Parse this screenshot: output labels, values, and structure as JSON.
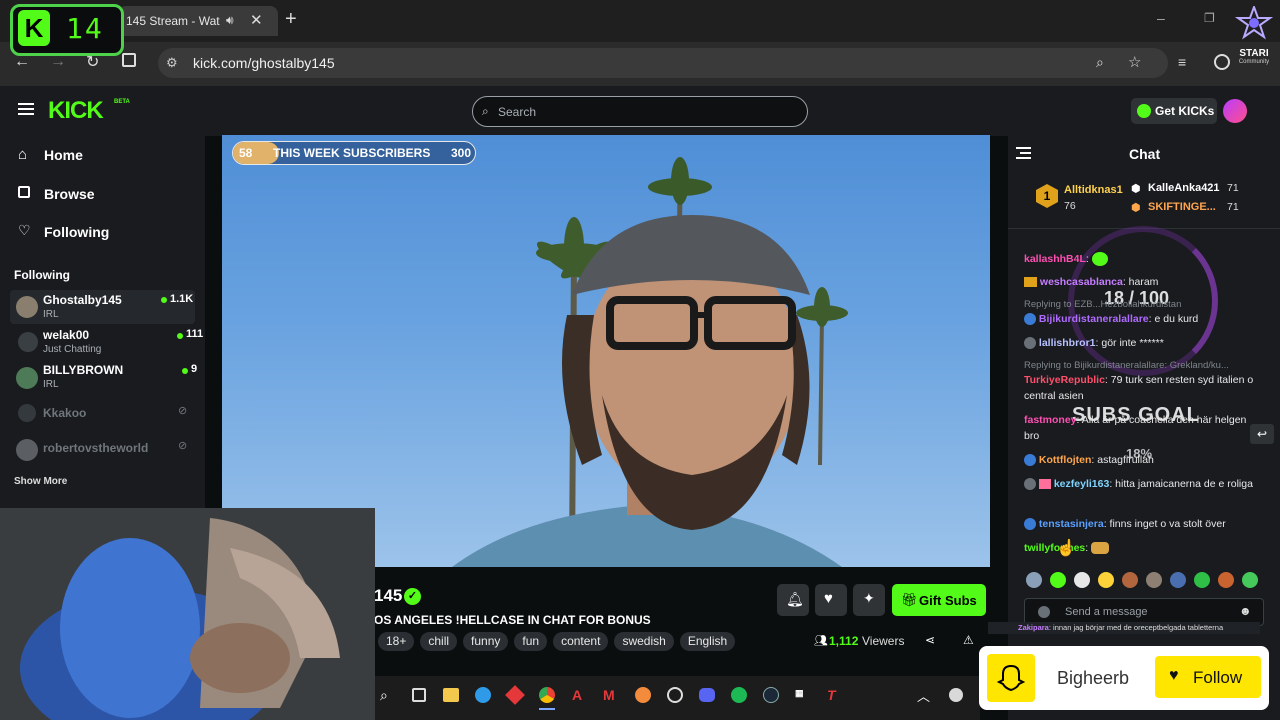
{
  "counter": {
    "k": "K",
    "value": "14"
  },
  "browser": {
    "tab_title": "145 Stream - Wat",
    "url": "kick.com/ghostalby145"
  },
  "corner_logo": {
    "label": "STARI",
    "sublabel": "Community"
  },
  "header": {
    "logo": "KICK",
    "logo_badge": "BETA",
    "search_placeholder": "Search",
    "get_kicks": "Get KICKs"
  },
  "sidebar": {
    "nav": [
      {
        "label": "Home",
        "icon": "home-icon"
      },
      {
        "label": "Browse",
        "icon": "browse-icon"
      },
      {
        "label": "Following",
        "icon": "heart-icon"
      }
    ],
    "following_title": "Following",
    "channels": [
      {
        "name": "Ghostalby145",
        "category": "IRL",
        "viewers": "1.1K",
        "live": true
      },
      {
        "name": "welak00",
        "category": "Just Chatting",
        "viewers": "111",
        "live": true
      },
      {
        "name": "BILLYBROWN",
        "category": "IRL",
        "viewers": "9",
        "live": true
      },
      {
        "name": "Kkakoo",
        "category": "",
        "viewers": "",
        "live": false
      },
      {
        "name": "robertovstheworld",
        "category": "",
        "viewers": "",
        "live": false
      }
    ],
    "show_more": "Show More"
  },
  "stream": {
    "subs_bar": {
      "current": "58",
      "label": "THIS WEEK SUBSCRIBERS",
      "target": "300",
      "progress_fraction": 0.19
    },
    "streamer_name": "145",
    "title": "OS ANGELES !HELLCASE IN CHAT FOR BONUS",
    "tags": [
      "18+",
      "chill",
      "funny",
      "fun",
      "content",
      "swedish",
      "English"
    ],
    "gift_subs": "Gift Subs",
    "viewers_count": "1,112",
    "viewers_label": "Viewers"
  },
  "chat": {
    "title": "Chat",
    "leaderboard": [
      {
        "rank": "1",
        "name": "Alltidknas1",
        "amount": "76"
      },
      {
        "name": "KalleAnka421",
        "amount": "71"
      },
      {
        "name": "SKIFTINGE...",
        "amount": "71"
      }
    ],
    "overlay_goal": {
      "progress_text": "18 / 100",
      "title": "SUBS GOAL",
      "percent": "18%"
    },
    "messages": [
      {
        "user": "kallashhB4L",
        "color": "#ff4fb3",
        "text": ""
      },
      {
        "user": "weshcasablanca",
        "color": "#c77dff",
        "text": "haram"
      },
      {
        "reply_to": "Replying to EZB...Hezbollahkurdistan"
      },
      {
        "user": "Bijikurdistaneralallare",
        "color": "#b06bff",
        "text": "e du kurd"
      },
      {
        "user": "lallishbror1",
        "color": "#b7c2ff",
        "text": "gör inte ******"
      },
      {
        "reply_to": "Replying to Bijikurdistaneralallare: Grekland/ku..."
      },
      {
        "user": "TurkiyeRepublic",
        "color": "#ff4f6b",
        "text": "79 turk sen resten syd italien o central asien"
      },
      {
        "user": "fastmoney",
        "color": "#ff4fb3",
        "text": "Alla är på coachella den här helgen bro"
      },
      {
        "user": "Kottflojten",
        "color": "#ffa64d",
        "text": "astagfirullah"
      },
      {
        "user": "kezfeyli163",
        "color": "#7fd4ff",
        "text": "hitta jamaicanerna de e roliga"
      },
      {
        "user": "tenstasinjera",
        "color": "#5aa0ff",
        "text": "finns inget o va stolt över"
      },
      {
        "user": "twillyformes",
        "color": "#53fc18",
        "text": ""
      }
    ],
    "send_placeholder": "Send a message",
    "ticker": {
      "user": "Zakipara",
      "text": "innan jag börjar med de oreceptbelgada tabletterna"
    }
  },
  "follow_card": {
    "name": "Bigheerb",
    "button": "Follow"
  },
  "colors": {
    "kick_green": "#53fc18",
    "panel": "#191b1f",
    "background": "#0b0e0f"
  }
}
